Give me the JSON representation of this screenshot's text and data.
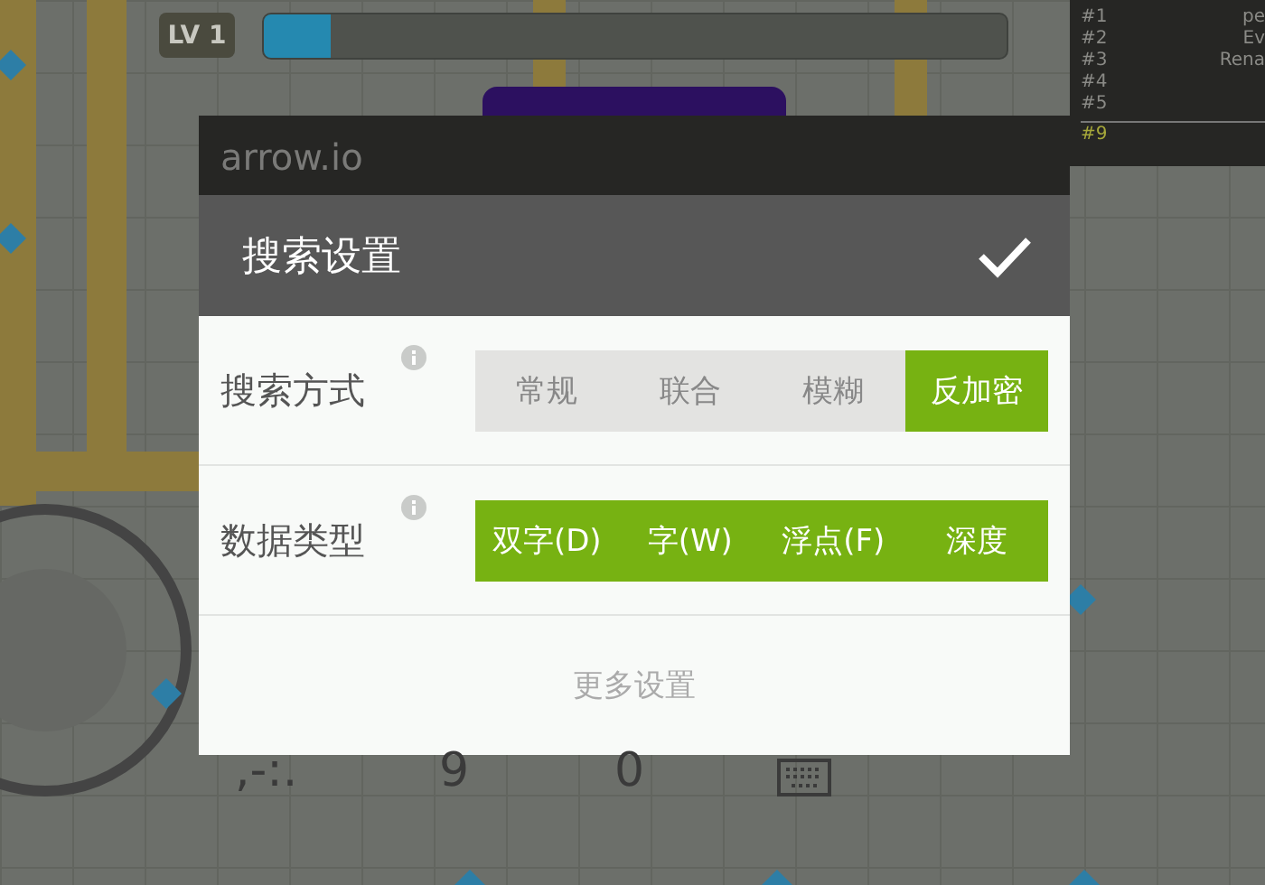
{
  "hud": {
    "level_badge": "LV 1",
    "xp": {
      "level": 0.09
    }
  },
  "leaderboard": [
    {
      "rank": "#1",
      "name": "pe",
      "highlighted": false
    },
    {
      "rank": "#2",
      "name": "Ev",
      "highlighted": false
    },
    {
      "rank": "#3",
      "name": "Rena",
      "highlighted": false
    },
    {
      "rank": "#4",
      "highlighted": false
    },
    {
      "rank": "#5",
      "highlighted": false
    },
    {
      "rank": "#9",
      "highlighted": true
    }
  ],
  "app_bar": {
    "title": "arrow.io"
  },
  "dialog": {
    "title": "搜索设置",
    "rows": [
      {
        "label": "搜索方式",
        "options": [
          {
            "label": "常规",
            "selected": false
          },
          {
            "label": "联合",
            "selected": false
          },
          {
            "label": "模糊",
            "selected": false
          },
          {
            "label": "反加密",
            "selected": true
          }
        ]
      },
      {
        "label": "数据类型",
        "options": [
          {
            "label": "双字(D)",
            "selected": true
          },
          {
            "label": "字(W)",
            "selected": true
          },
          {
            "label": "浮点(F)",
            "selected": true
          },
          {
            "label": "深度",
            "selected": true
          }
        ]
      }
    ],
    "more": "更多设置"
  },
  "keypad": [
    ",-:.",
    "9",
    "0"
  ]
}
